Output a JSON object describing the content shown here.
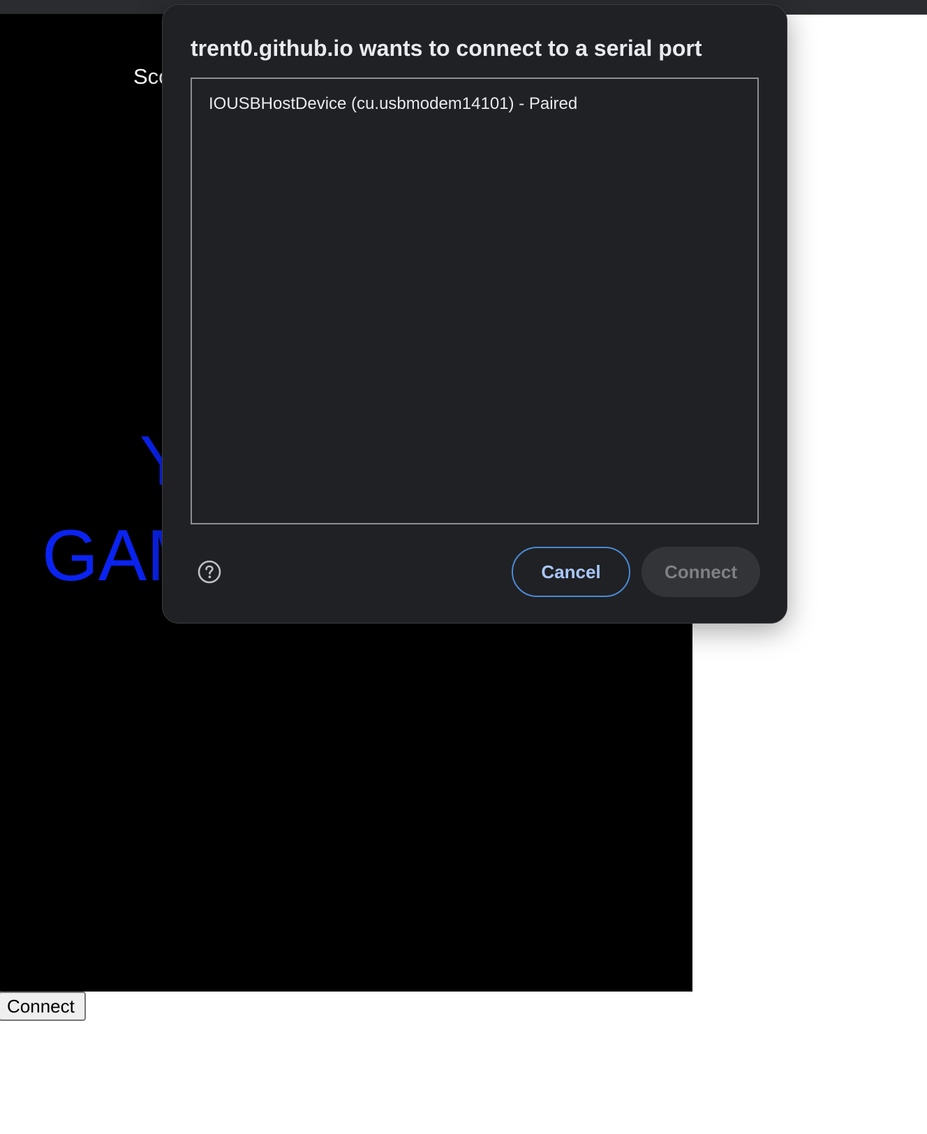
{
  "page": {
    "score_label": "Sco",
    "game_over_line1": "Y",
    "game_over_line2": "GAM",
    "connect_button": "Connect",
    "game_text_color": "#0a23f0"
  },
  "dialog": {
    "title": "trent0.github.io wants to connect to a serial port",
    "ports": [
      {
        "label": "IOUSBHostDevice (cu.usbmodem14101) - Paired"
      }
    ],
    "help_icon": "help-circle-icon",
    "cancel_label": "Cancel",
    "connect_label": "Connect",
    "connect_enabled": false,
    "accent_color": "#a8c7fa"
  }
}
